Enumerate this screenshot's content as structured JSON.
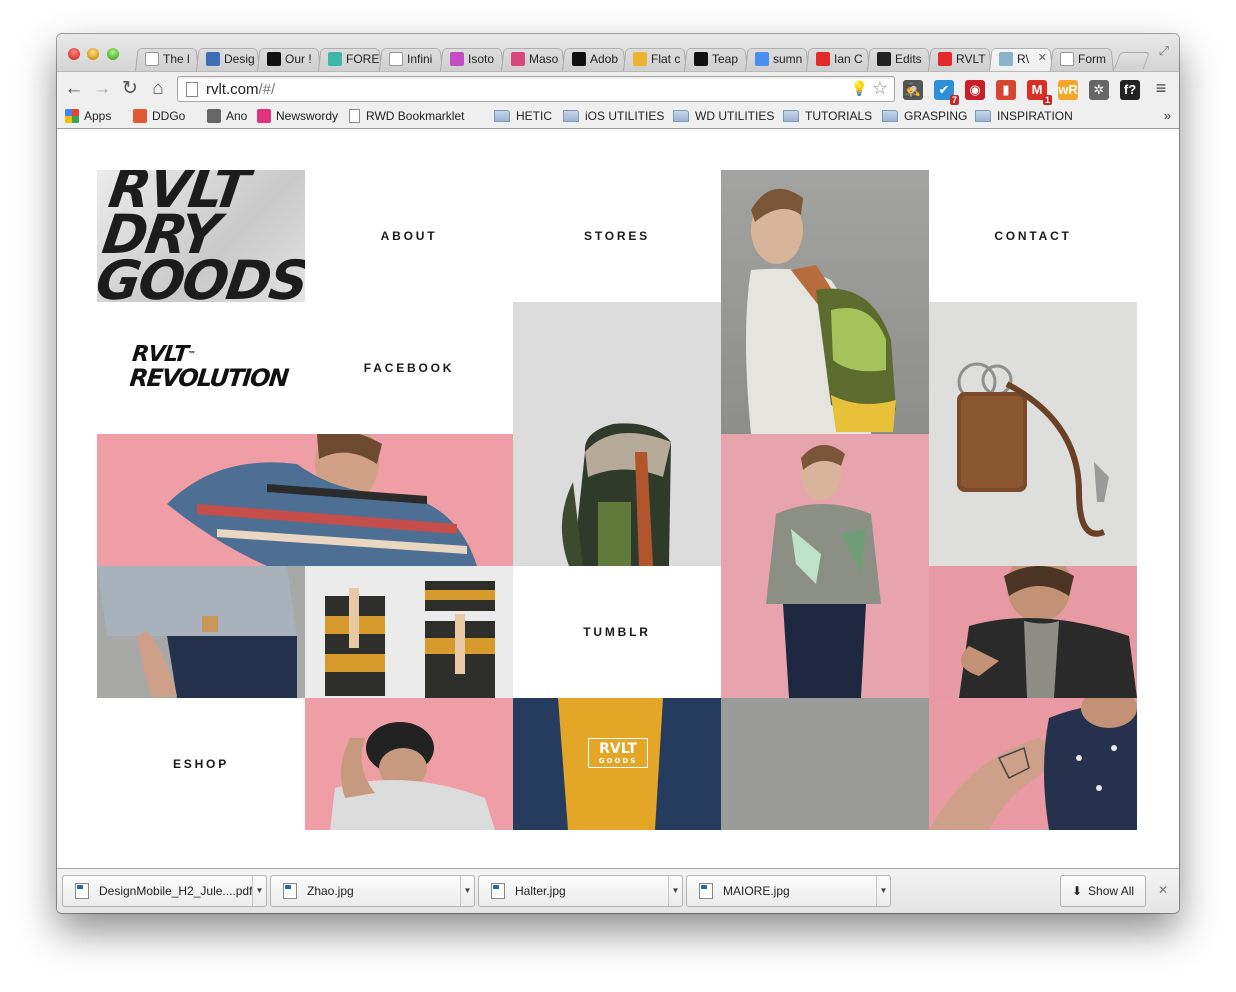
{
  "browser": {
    "tabs": [
      {
        "label": "The l",
        "icon": "page-icon",
        "color": "#ffffff"
      },
      {
        "label": "Desig",
        "icon": "grid-icon",
        "color": "#3b6fb6"
      },
      {
        "label": "Our !",
        "icon": "bolt-icon",
        "color": "#111111"
      },
      {
        "label": "FORE",
        "icon": "triangle-icon",
        "color": "#3fb6a8"
      },
      {
        "label": "Infini",
        "icon": "page-icon",
        "color": "#ffffff"
      },
      {
        "label": "Isoto",
        "icon": "isotope-icon",
        "color": "#c44dc4"
      },
      {
        "label": "Maso",
        "icon": "d-icon",
        "color": "#d9487a"
      },
      {
        "label": "Adob",
        "icon": "n-icon",
        "color": "#111111"
      },
      {
        "label": "Flat c",
        "icon": "face-icon",
        "color": "#f0b431"
      },
      {
        "label": "Teap",
        "icon": "t-icon",
        "color": "#111111"
      },
      {
        "label": "sumn",
        "icon": "google-icon",
        "color": "#4a8ef0"
      },
      {
        "label": "Ian C",
        "icon": "circle-icon",
        "color": "#e32b2b"
      },
      {
        "label": "Edits",
        "icon": "edits-icon",
        "color": "#222222"
      },
      {
        "label": "RVLT",
        "icon": "circle-icon",
        "color": "#e32b2b"
      },
      {
        "label": "R\\",
        "icon": "rvlt-icon",
        "color": "#8ab4c9"
      },
      {
        "label": "Form",
        "icon": "fff-icon",
        "color": "#ffffff"
      }
    ],
    "active_tab_index": 14,
    "tab_close_glyph": "✕",
    "url_host": "rvlt.com",
    "url_path": "/#/",
    "bookmarks": {
      "apps": "Apps",
      "items": [
        {
          "label": "DDGo",
          "type": "icon",
          "color": "#de5833"
        },
        {
          "label": "Ano",
          "type": "icon",
          "color": "#666666"
        },
        {
          "label": "Newswordy",
          "type": "icon",
          "color": "#e3337e"
        },
        {
          "label": "RWD Bookmarklet",
          "type": "page"
        },
        {
          "label": "HETIC",
          "type": "folder"
        },
        {
          "label": "iOS UTILITIES",
          "type": "folder"
        },
        {
          "label": "WD UTILITIES",
          "type": "folder"
        },
        {
          "label": "TUTORIALS",
          "type": "folder"
        },
        {
          "label": "GRASPING",
          "type": "folder"
        },
        {
          "label": "INSPIRATION",
          "type": "folder"
        }
      ],
      "more": "»"
    },
    "extensions": [
      {
        "name": "spy-icon",
        "glyph": "🕵",
        "color": "#555555"
      },
      {
        "name": "check-icon",
        "glyph": "✔",
        "color": "#2e8fd6",
        "badge": "7"
      },
      {
        "name": "lastpass-icon",
        "glyph": "◉",
        "color": "#c8202a"
      },
      {
        "name": "bookmark-icon",
        "glyph": "▮",
        "color": "#d6462e"
      },
      {
        "name": "gmail-icon",
        "glyph": "M",
        "color": "#d93025",
        "badge": "1"
      },
      {
        "name": "wr-icon",
        "glyph": "wR",
        "color": "#f4a62a"
      },
      {
        "name": "bug-icon",
        "glyph": "✲",
        "color": "#666666"
      },
      {
        "name": "font-icon",
        "glyph": "f?",
        "color": "#222222"
      }
    ]
  },
  "site": {
    "nav": {
      "about": "ABOUT",
      "stores": "STORES",
      "contact": "CONTACT",
      "facebook": "FACEBOOK",
      "tumblr": "TUMBLR",
      "eshop": "ESHOP"
    },
    "logo_poster": "RVLT DRY GOODS",
    "logo_revolution_line1": "RVLT",
    "logo_revolution_line2": "REVOLUTION",
    "tm": "™",
    "tee_print": "RVLT",
    "tee_print_sub": "GOODS"
  },
  "downloads": {
    "items": [
      {
        "filename": "DesignMobile_H2_Jule....pdf"
      },
      {
        "filename": "Zhao.jpg"
      },
      {
        "filename": "Halter.jpg"
      },
      {
        "filename": "MAIORE.jpg"
      }
    ],
    "show_all": "Show All",
    "close_glyph": "✕"
  }
}
